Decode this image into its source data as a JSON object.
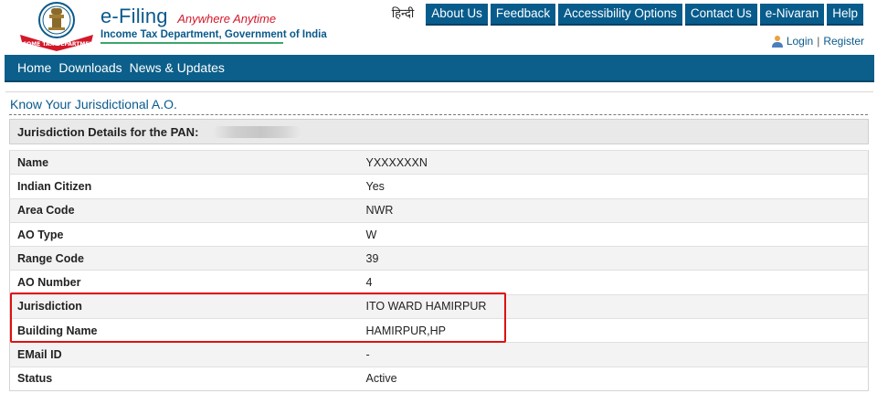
{
  "header": {
    "brand_name": "e-Filing",
    "tagline": "Anywhere Anytime",
    "department": "Income Tax Department, Government of India",
    "emblem_caption": "INCOME TAX DEPARTMENT"
  },
  "top_nav": {
    "language": "हिन्दी",
    "items": [
      {
        "label": "About Us"
      },
      {
        "label": "Feedback"
      },
      {
        "label": "Accessibility Options"
      },
      {
        "label": "Contact Us"
      },
      {
        "label": "e-Nivaran"
      },
      {
        "label": "Help"
      }
    ],
    "login": "Login",
    "separator": "|",
    "register": "Register"
  },
  "main_nav": {
    "items": [
      {
        "label": "Home"
      },
      {
        "label": "Downloads"
      },
      {
        "label": "News & Updates"
      }
    ]
  },
  "page": {
    "title": "Know Your Jurisdictional A.O.",
    "pan_label": "Jurisdiction Details for the PAN:",
    "rows": [
      {
        "key": "Name",
        "value": "YXXXXXXN"
      },
      {
        "key": "Indian Citizen",
        "value": "Yes"
      },
      {
        "key": "Area Code",
        "value": "NWR"
      },
      {
        "key": "AO Type",
        "value": "W"
      },
      {
        "key": "Range Code",
        "value": "39"
      },
      {
        "key": "AO Number",
        "value": "4"
      },
      {
        "key": "Jurisdiction",
        "value": "ITO WARD HAMIRPUR"
      },
      {
        "key": "Building Name",
        "value": "HAMIRPUR,HP"
      },
      {
        "key": "EMail ID",
        "value": "-"
      },
      {
        "key": "Status",
        "value": "Active"
      }
    ]
  },
  "colors": {
    "brand_blue": "#0a5a8c",
    "nav_blue": "#0b5f8a",
    "tagline_red": "#d3182a",
    "highlight_red": "#e01010"
  }
}
